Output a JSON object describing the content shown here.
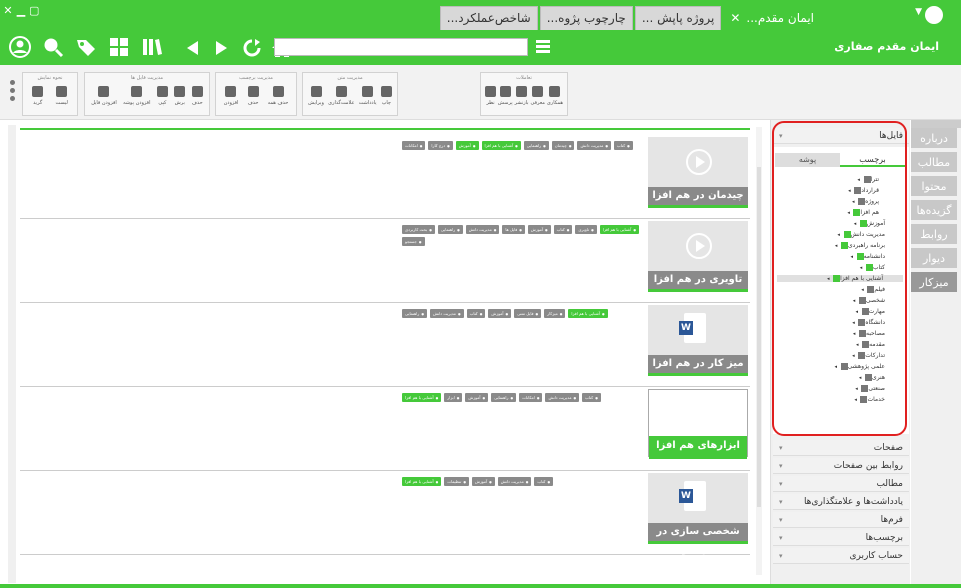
{
  "window": {
    "close_icon": "close-icon",
    "minimize_icon": "minimize-icon",
    "maximize_icon": "maximize-icon"
  },
  "tabs": [
    {
      "label": "ایمان مقدم...",
      "active": true
    },
    {
      "label": "پروژه پاپش ...",
      "active": false
    },
    {
      "label": "چارچوب پژوه...",
      "active": false
    },
    {
      "label": "شاخص‌عملکرد...",
      "active": false
    }
  ],
  "header": {
    "user_name": "ایمان مقدم صفاری",
    "search_placeholder": ""
  },
  "ribbon": {
    "groups": [
      {
        "title": "تعاملات",
        "items": [
          "نظر",
          "پرسش",
          "بازنشر",
          "معرفی",
          "همکاری"
        ]
      },
      {
        "title": "مدیریت متن",
        "items": [
          "ویرایش",
          "علامت‌گذاری",
          "یادداشت",
          "چاپ"
        ]
      },
      {
        "title": "مدیریت برچسب",
        "items": [
          "افزودن",
          "حذف",
          "حذف همه"
        ]
      },
      {
        "title": "مدیریت فایل ها",
        "items": [
          "افزودن فایل",
          "افزودن پوشه",
          "کپی",
          "برش",
          "حذف"
        ]
      },
      {
        "title": "نحوه نمایش",
        "items": [
          "گرید",
          "لیست"
        ]
      }
    ]
  },
  "items": [
    {
      "title": "چیدمان در هم افزا",
      "type": "video",
      "selected": false,
      "tags": [
        {
          "t": "کتاب",
          "g": false
        },
        {
          "t": "مدیریت دانش",
          "g": false
        },
        {
          "t": "چیدمان",
          "g": false
        },
        {
          "t": "راهنمایی",
          "g": false
        },
        {
          "t": "آشنایی با هم افزا",
          "g": true
        },
        {
          "t": "آموزش",
          "g": true
        },
        {
          "t": "درج کارا",
          "g": false
        },
        {
          "t": "امکانات",
          "g": false
        }
      ]
    },
    {
      "title": "تاویری در هم افزا",
      "type": "video",
      "selected": false,
      "tags": [
        {
          "t": "آشنایی با هم افزا",
          "g": true
        },
        {
          "t": "تاویری",
          "g": false
        },
        {
          "t": "کتاب",
          "g": false
        },
        {
          "t": "آموزش",
          "g": false
        },
        {
          "t": "فایل ها",
          "g": false
        },
        {
          "t": "مدیریت دانش",
          "g": false
        },
        {
          "t": "راهنمایی",
          "g": false
        },
        {
          "t": "بحث کاربردی",
          "g": false
        },
        {
          "t": "جستجو",
          "g": false
        }
      ]
    },
    {
      "title": "میز کار در هم افزا",
      "type": "doc",
      "selected": false,
      "tags": [
        {
          "t": "آشنایی با هم افزا",
          "g": true
        },
        {
          "t": "میزکار",
          "g": false
        },
        {
          "t": "فایل متنی",
          "g": false
        },
        {
          "t": "آموزش",
          "g": false
        },
        {
          "t": "کتاب",
          "g": false
        },
        {
          "t": "مدیریت دانش",
          "g": false
        },
        {
          "t": "راهنمایی",
          "g": false
        }
      ]
    },
    {
      "title": "ابزارهای هم افزا",
      "type": "video",
      "selected": true,
      "tags": [
        {
          "t": "کتاب",
          "g": false
        },
        {
          "t": "مدیریت دانش",
          "g": false
        },
        {
          "t": "امکانات",
          "g": false
        },
        {
          "t": "راهنمایی",
          "g": false
        },
        {
          "t": "آموزش",
          "g": false
        },
        {
          "t": "ابزار",
          "g": false
        },
        {
          "t": "آشنایی با هم افزا",
          "g": true
        }
      ]
    },
    {
      "title": "شخصی سازی در هم افزا",
      "type": "doc",
      "selected": false,
      "tags": [
        {
          "t": "کتاب",
          "g": false
        },
        {
          "t": "مدیریت دانش",
          "g": false
        },
        {
          "t": "آموزش",
          "g": false
        },
        {
          "t": "تنظیمات",
          "g": false
        },
        {
          "t": "آشنایی با هم افزا",
          "g": true
        }
      ]
    }
  ],
  "right_panel": {
    "files_header": "فایل‌ها",
    "subtabs": [
      "برچسب",
      "پوشه"
    ],
    "tree": [
      {
        "t": "تترا",
        "g": false,
        "d": 0,
        "sel": false
      },
      {
        "t": "قرارداد",
        "g": false,
        "d": 0,
        "sel": false
      },
      {
        "t": "پروژه",
        "g": false,
        "d": 0,
        "sel": false
      },
      {
        "t": "هم افزا",
        "g": true,
        "d": 0,
        "sel": false
      },
      {
        "t": "آموزش",
        "g": true,
        "d": 1,
        "sel": false
      },
      {
        "t": "مدیریت دانش",
        "g": true,
        "d": 1,
        "sel": false
      },
      {
        "t": "برنامه راهبردی",
        "g": true,
        "d": 1,
        "sel": false
      },
      {
        "t": "دانشنامه",
        "g": true,
        "d": 1,
        "sel": false
      },
      {
        "t": "کتاب",
        "g": true,
        "d": 1,
        "sel": false
      },
      {
        "t": "آشنایی با هم افزا",
        "g": true,
        "d": 1,
        "sel": true
      },
      {
        "t": "فیلم",
        "g": false,
        "d": 1,
        "sel": false
      },
      {
        "t": "شخصی",
        "g": false,
        "d": 1,
        "sel": false
      },
      {
        "t": "مهارت",
        "g": false,
        "d": 1,
        "sel": false
      },
      {
        "t": "دانشگاه",
        "g": false,
        "d": 1,
        "sel": false
      },
      {
        "t": "مصاحبه",
        "g": false,
        "d": 1,
        "sel": false
      },
      {
        "t": "مقدمه",
        "g": false,
        "d": 1,
        "sel": false
      },
      {
        "t": "تدارکات",
        "g": false,
        "d": 1,
        "sel": false
      },
      {
        "t": "علمی پژوهشی",
        "g": false,
        "d": 1,
        "sel": false
      },
      {
        "t": "هنری",
        "g": false,
        "d": 1,
        "sel": false
      },
      {
        "t": "صنعتی",
        "g": false,
        "d": 1,
        "sel": false
      },
      {
        "t": "خدمات",
        "g": false,
        "d": 1,
        "sel": false
      }
    ],
    "sections": [
      "صفحات",
      "روابط بین صفحات",
      "مطالب",
      "یادداشت‌ها و علامتگذاری‌ها",
      "فرم‌ها",
      "برچسب‌ها",
      "حساب کاربری"
    ]
  },
  "side_nav": [
    "درباره",
    "مطالب",
    "محتوا",
    "گزیده‌ها",
    "روابط",
    "دیوار",
    "میزکار"
  ],
  "side_nav_active": "میزکار",
  "colors": {
    "accent": "#45c93a",
    "highlight": "#e02020"
  }
}
